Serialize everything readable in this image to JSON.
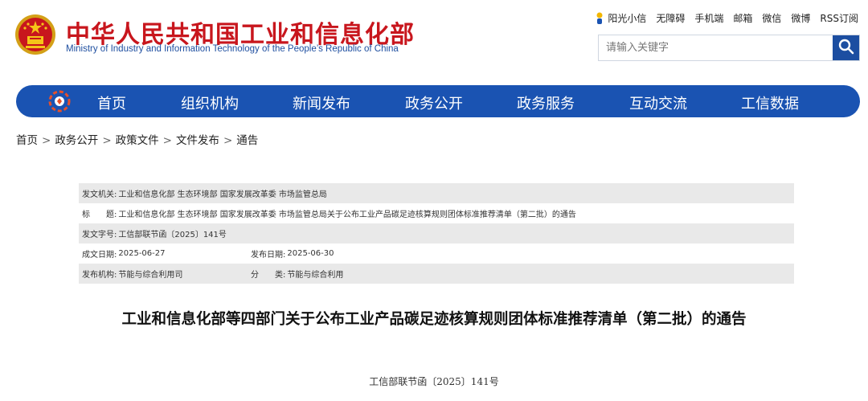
{
  "header": {
    "title_cn": "中华人民共和国工业和信息化部",
    "title_en": "Ministry of Industry and Information Technology of the People’s Republic of China",
    "emblem_icon": "national-emblem-icon",
    "brand_red": "#c8161d",
    "brand_blue": "#1a53b2"
  },
  "toplinks": [
    {
      "label": "阳光小信",
      "icon": "sunshine-mascot-icon"
    },
    {
      "label": "无障碍"
    },
    {
      "label": "手机端"
    },
    {
      "label": "邮箱"
    },
    {
      "label": "微信"
    },
    {
      "label": "微博"
    },
    {
      "label": "RSS订阅"
    }
  ],
  "search": {
    "placeholder": "请输入关键字",
    "value": "",
    "button_icon": "search-icon"
  },
  "nav": {
    "logo_icon": "miit-logo-icon",
    "items": [
      "首页",
      "组织机构",
      "新闻发布",
      "政务公开",
      "政务服务",
      "互动交流",
      "工信数据"
    ]
  },
  "breadcrumb": [
    "首页",
    "政务公开",
    "政策文件",
    "文件发布",
    "通告"
  ],
  "breadcrumb_sep": ">",
  "meta": {
    "issuer_label": "发文机关:",
    "issuer": "工业和信息化部 生态环境部 国家发展改革委 市场监管总局",
    "title_label": "标　　题:",
    "title": "工业和信息化部 生态环境部 国家发展改革委 市场监管总局关于公布工业产品碳足迹核算规则团体标准推荐清单（第二批）的通告",
    "doc_no_label": "发文字号:",
    "doc_no": "工信部联节函〔2025〕141号",
    "written_label": "成文日期:",
    "written": "2025-06-27",
    "published_label": "发布日期:",
    "published": "2025-06-30",
    "org_label": "发布机构:",
    "org": "节能与综合利用司",
    "category_label": "分　　类:",
    "category": "节能与综合利用"
  },
  "article": {
    "title": "工业和信息化部等四部门关于公布工业产品碳足迹核算规则团体标准推荐清单（第二批）的通告",
    "doc_number": "工信部联节函〔2025〕141号"
  }
}
